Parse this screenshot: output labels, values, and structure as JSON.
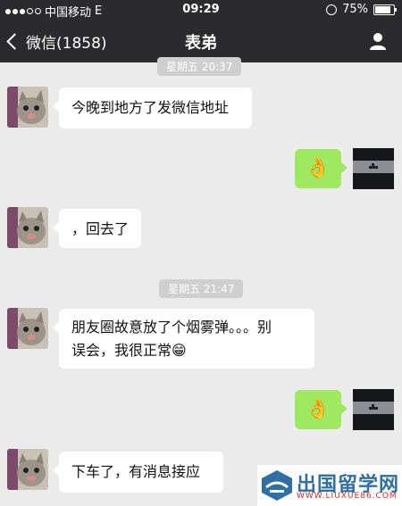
{
  "status": {
    "carrier": "中国移动",
    "network": "E",
    "time": "09:29",
    "battery": "75%",
    "signal_dots_filled": 3,
    "signal_dots_total": 5,
    "battery_level": 0.75
  },
  "nav": {
    "back_label": "微信(1858)",
    "title": "表弟"
  },
  "messages": [
    {
      "time_label": "星期五 20:37"
    },
    {
      "text": "今晚到地方了发微信地址"
    },
    {
      "emoji": "👌"
    },
    {
      "text": "，回去了"
    },
    {
      "time_label": "星期五 21:47"
    },
    {
      "text_line1": "朋友圈故意放了个烟雾弹。。。别",
      "text_line2": "误会，我很正常",
      "emoji_after": "😁"
    },
    {
      "emoji": "👌"
    },
    {
      "text": "下车了，有消息接应"
    }
  ],
  "watermark": {
    "name": "出国留学网",
    "url": "WWW.LIUXUE86.COM"
  },
  "colors": {
    "bar": "#2b2b2d",
    "background": "#ebebeb",
    "my_bubble": "#9ee960",
    "their_bubble": "#ffffff"
  }
}
